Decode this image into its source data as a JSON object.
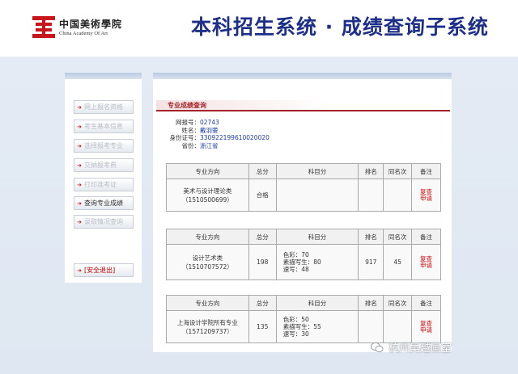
{
  "header": {
    "logo_cn": "中国美術學院",
    "logo_en": "China Academy Of Art",
    "title": "本科招生系统 · 成绩查询子系统"
  },
  "sidebar": {
    "items": [
      {
        "label": "网上报名资格",
        "active": false
      },
      {
        "label": "考生基本信息",
        "active": false
      },
      {
        "label": "选择报考专业",
        "active": false
      },
      {
        "label": "交纳报考费",
        "active": false
      },
      {
        "label": "打印准考证",
        "active": false
      },
      {
        "label": "查询专业成绩",
        "active": true
      },
      {
        "label": "录取情况查询",
        "active": false
      }
    ],
    "logout": "[安全退出]"
  },
  "main": {
    "section_title": "专业成绩查询",
    "info": {
      "labels": [
        "网报号：",
        "姓名：",
        "身份证号：",
        "省份："
      ],
      "values": [
        "02743",
        "戴羽蓥",
        "330922199610020020",
        "浙江省"
      ]
    },
    "table_headers": [
      "专业方向",
      "总分",
      "科目分",
      "排名",
      "同名次",
      "备注"
    ],
    "tables": [
      {
        "major": "美术与设计理论类",
        "code": "（1510500699）",
        "total": "合格",
        "scores": [],
        "rank": "",
        "same_rank": "",
        "note_1": "复查",
        "note_2": "申请"
      },
      {
        "major": "设计艺术类",
        "code": "（1510707572）",
        "total": "198",
        "scores": [
          "色彩：70",
          "素描写生：80",
          "速写：48"
        ],
        "rank": "917",
        "same_rank": "45",
        "note_1": "复查",
        "note_2": "申请"
      },
      {
        "major": "上海设计学院所有专业",
        "code": "（1571209737）",
        "total": "135",
        "scores": [
          "色彩：50",
          "素描写生：55",
          "速写：30"
        ],
        "rank": "",
        "same_rank": "",
        "note_1": "复查",
        "note_2": "申请"
      }
    ]
  },
  "watermark": "杭州吴越画室",
  "colors": {
    "title_blue": "#1d2f88",
    "accent_red": "#a4232a",
    "logo_red": "#c8161d",
    "value_blue": "#1a3da8"
  }
}
